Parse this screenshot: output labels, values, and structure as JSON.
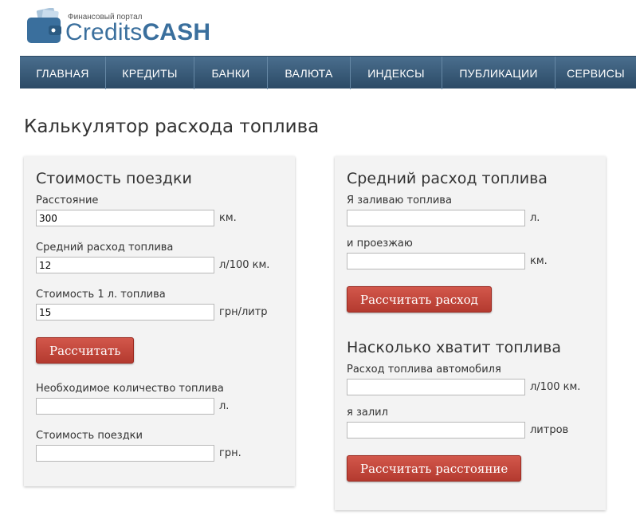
{
  "logo": {
    "tagline": "Финансовый портал",
    "brand_light": "Credits",
    "brand_bold": "CASH",
    "accent": "#3a6f9d"
  },
  "nav": {
    "items": [
      "ГЛАВНАЯ",
      "КРЕДИТЫ",
      "БАНКИ",
      "ВАЛЮТА",
      "ИНДЕКСЫ",
      "ПУБЛИКАЦИИ",
      "СЕРВИСЫ"
    ]
  },
  "page_title": "Калькулятор расхода топлива",
  "trip_cost": {
    "heading": "Стоимость поездки",
    "distance_label": "Расстояние",
    "distance_value": "300",
    "distance_unit": "км.",
    "consumption_label": "Средний расход топлива",
    "consumption_value": "12",
    "consumption_unit": "л/100 км.",
    "price_label": "Стоимость 1 л. топлива",
    "price_value": "15",
    "price_unit": "грн/литр",
    "calc_button": "Рассчитать",
    "fuel_needed_label": "Необходимое количество топлива",
    "fuel_needed_value": "",
    "fuel_needed_unit": "л.",
    "trip_cost_label": "Стоимость поездки",
    "trip_cost_value": "",
    "trip_cost_unit": "грн."
  },
  "avg_consumption": {
    "heading": "Средний расход топлива",
    "fuel_label": "Я заливаю топлива",
    "fuel_value": "",
    "fuel_unit": "л.",
    "drive_label": "и проезжаю",
    "drive_value": "",
    "drive_unit": "км.",
    "calc_button": "Рассчитать расход"
  },
  "range": {
    "heading": "Насколько хватит топлива",
    "consumption_label": "Расход топлива автомобиля",
    "consumption_value": "",
    "consumption_unit": "л/100 км.",
    "filled_label": "я залил",
    "filled_value": "",
    "filled_unit": "литров",
    "calc_button": "Рассчитать расстояние"
  },
  "colors": {
    "nav_bg": "#3a5a78",
    "button_red": "#c0463b",
    "panel_bg": "#f3f3f3"
  }
}
